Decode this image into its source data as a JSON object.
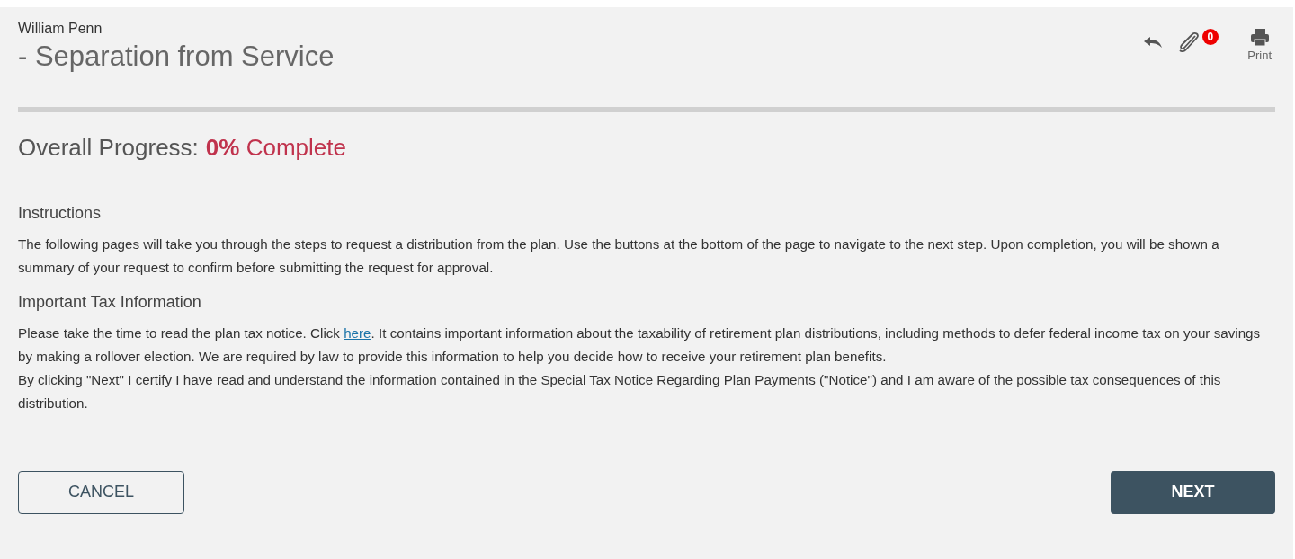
{
  "header": {
    "name": "William Penn",
    "title": "- Separation from Service",
    "actions": {
      "attachment_count": "0",
      "print_label": "Print"
    }
  },
  "progress": {
    "label": "Overall Progress:",
    "percent": "0%",
    "suffix": "Complete"
  },
  "sections": [
    {
      "heading": "Instructions",
      "paragraphs": [
        {
          "before": "The following pages will take you through the steps to request a distribution from the plan. Use the buttons at the bottom of the page to navigate to the next step. Upon completion, you will be shown a summary of your request to confirm before submitting the request for approval."
        }
      ]
    },
    {
      "heading": "Important Tax Information",
      "paragraphs": [
        {
          "before": "Please take the time to read the plan tax notice. Click ",
          "link": "here",
          "after": ". It contains important information about the taxability of retirement plan distributions, including methods to defer federal income tax on your savings by making a rollover election. We are required by law to provide this information to help you decide how to receive your retirement plan benefits."
        },
        {
          "before": "By clicking \"Next\" I certify I have read and understand the information contained in the Special Tax Notice Regarding Plan Payments (\"Notice\") and I am aware of the possible tax consequences of this distribution."
        }
      ]
    }
  ],
  "buttons": {
    "cancel": "CANCEL",
    "next": "NEXT"
  }
}
